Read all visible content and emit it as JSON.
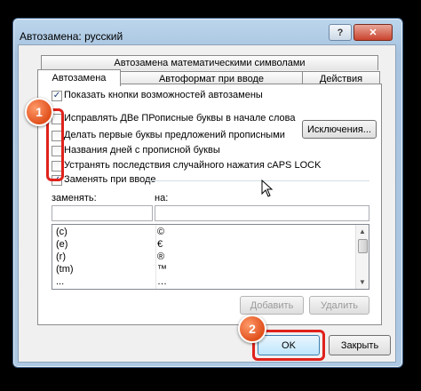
{
  "window": {
    "title": "Автозамена: русский",
    "help_button": "?",
    "close_button": "✕"
  },
  "tabs": {
    "row_top": "Автозамена математическими символами",
    "row_bottom": [
      "Автозамена",
      "Автоформат при вводе",
      "Действия"
    ]
  },
  "options": {
    "show_buttons": "Показать кнопки возможностей автозамены",
    "fix_two_caps": "Исправлять ДВе ПРописные буквы в начале слова",
    "capitalize_sentences": "Делать первые буквы предложений прописными",
    "capitalize_days": "Названия дней с прописной буквы",
    "fix_caps_lock": "Устранять последствия случайного нажатия cAPS LOCK",
    "replace_as_type": "Заменять при вводе"
  },
  "exceptions_button": "Исключения...",
  "replace_table": {
    "replace_label": "заменять:",
    "with_label": "на:",
    "replace_value": "",
    "with_value": "",
    "rows": [
      {
        "from": "(c)",
        "to": "©"
      },
      {
        "from": "(e)",
        "to": "€"
      },
      {
        "from": "(r)",
        "to": "®"
      },
      {
        "from": "(tm)",
        "to": "™"
      },
      {
        "from": "...",
        "to": "…"
      }
    ]
  },
  "add_button": "Добавить",
  "delete_button": "Удалить",
  "ok_button": "OK",
  "close_button": "Закрыть",
  "annotations": {
    "badge1": "1",
    "badge2": "2"
  },
  "colors": {
    "highlight": "#e0221c",
    "badge": "#e0501c",
    "checkmark": "#1a3a7a"
  }
}
